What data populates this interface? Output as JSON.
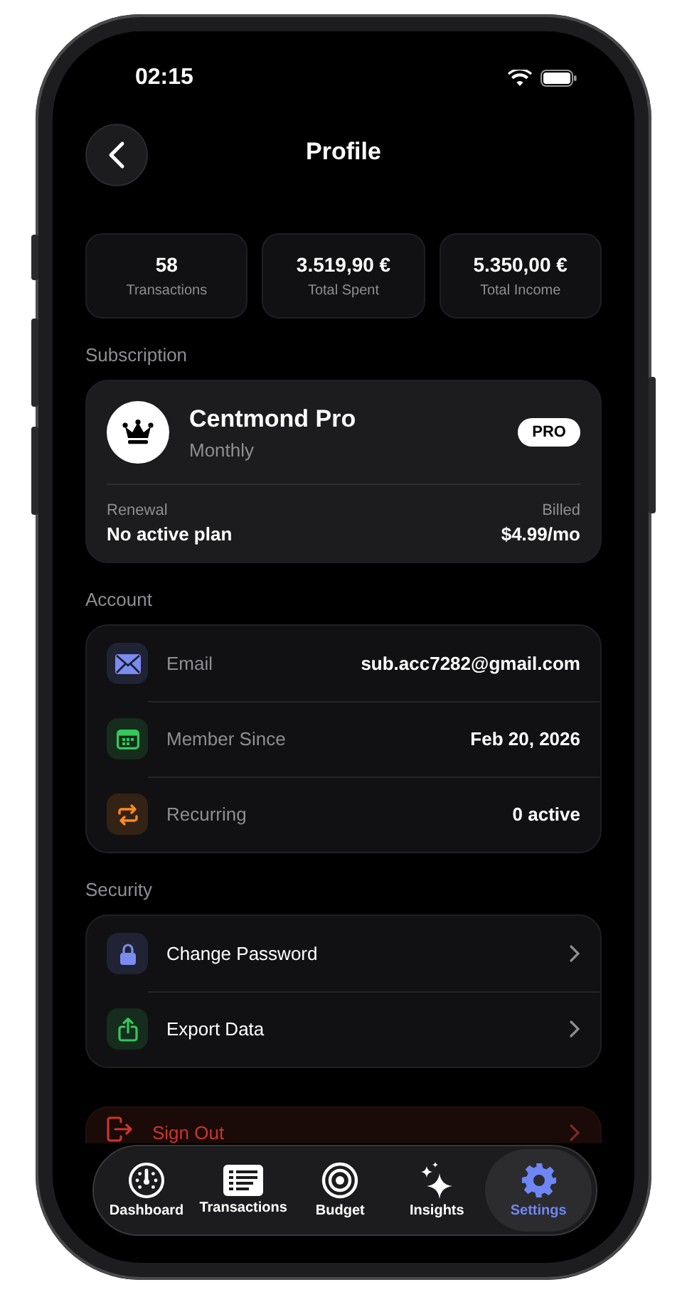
{
  "status_bar": {
    "time": "02:15"
  },
  "header": {
    "title": "Profile"
  },
  "stats": [
    {
      "value": "58",
      "label": "Transactions"
    },
    {
      "value": "3.519,90 €",
      "label": "Total Spent"
    },
    {
      "value": "5.350,00 €",
      "label": "Total Income"
    }
  ],
  "subscription": {
    "section": "Subscription",
    "plan": "Centmond Pro",
    "period": "Monthly",
    "badge": "PRO",
    "renewal_label": "Renewal",
    "renewal_value": "No active plan",
    "billed_label": "Billed",
    "billed_value": "$4.99/mo"
  },
  "account": {
    "section": "Account",
    "rows": [
      {
        "kind": "mail",
        "color": "#7b8cf0",
        "label": "Email",
        "value": "sub.acc7282@gmail.com"
      },
      {
        "kind": "calendar",
        "color": "#34c759",
        "label": "Member Since",
        "value": "Feb 20, 2026"
      },
      {
        "kind": "repeat",
        "color": "#ff8a1e",
        "label": "Recurring",
        "value": "0 active"
      }
    ]
  },
  "security": {
    "section": "Security",
    "rows": [
      {
        "kind": "lock",
        "color": "#7b8cf0",
        "label": "Change Password"
      },
      {
        "kind": "share",
        "color": "#34c759",
        "label": "Export Data"
      }
    ]
  },
  "sign_out": {
    "label": "Sign Out"
  },
  "tabs": [
    {
      "kind": "gauge",
      "label": "Dashboard",
      "selected": false
    },
    {
      "kind": "list",
      "label": "Transactions",
      "selected": false
    },
    {
      "kind": "target",
      "label": "Budget",
      "selected": false
    },
    {
      "kind": "sparkles",
      "label": "Insights",
      "selected": false
    },
    {
      "kind": "gear",
      "label": "Settings",
      "selected": true
    }
  ]
}
